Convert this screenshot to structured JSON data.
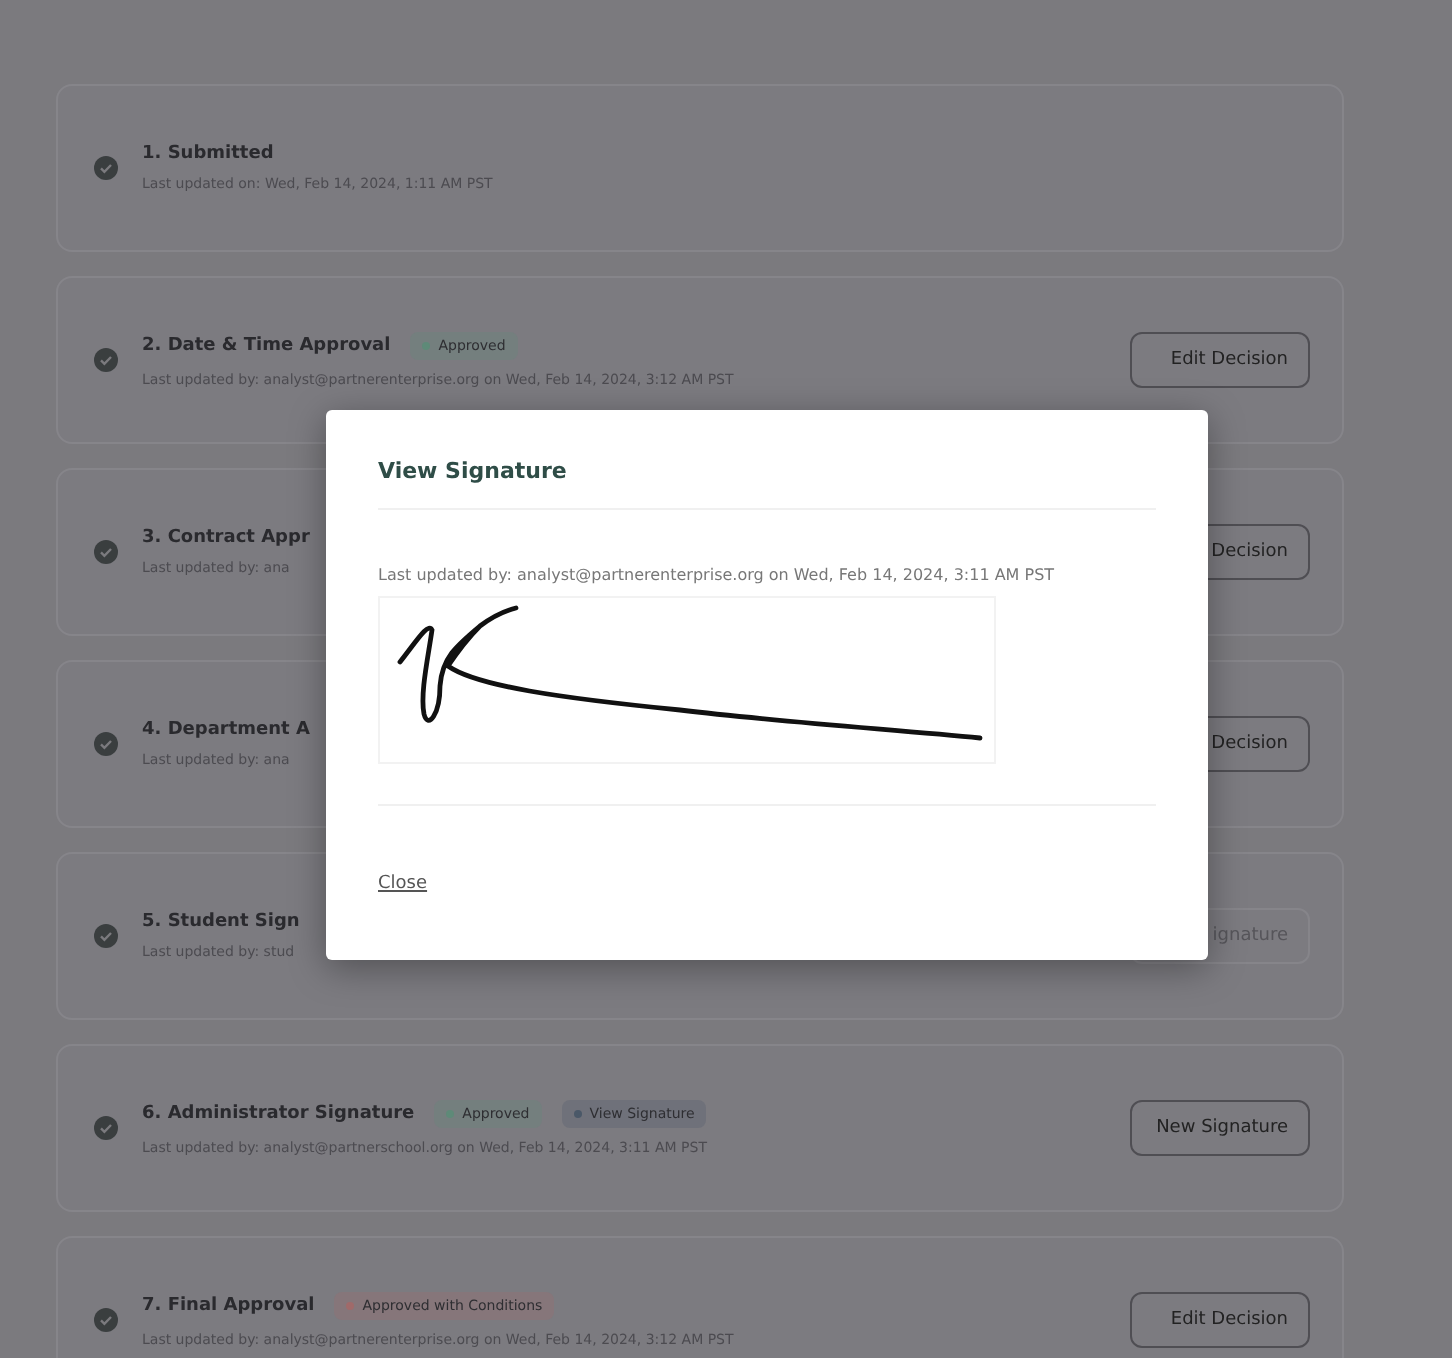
{
  "steps": [
    {
      "title": "1. Submitted",
      "subtitle": "Last updated on: Wed, Feb 14, 2024, 1:11 AM PST"
    },
    {
      "title": "2. Date & Time Approval",
      "subtitle": "Last updated by: analyst@partnerenterprise.org on Wed, Feb 14, 2024, 3:12 AM PST",
      "badges": [
        {
          "label": "Approved",
          "color": "#5e8a78"
        }
      ],
      "button": {
        "label": "Edit Decision",
        "disabled": false
      }
    },
    {
      "title": "3. Contract Appr",
      "subtitle": "Last updated by: ana",
      "button": {
        "label": "Decision",
        "disabled": false
      }
    },
    {
      "title": "4. Department A",
      "subtitle": "Last updated by: ana",
      "button": {
        "label": "Decision",
        "disabled": false
      }
    },
    {
      "title": "5. Student Sign",
      "subtitle": "Last updated by: stud",
      "button": {
        "label": "ignature",
        "disabled": true
      }
    },
    {
      "title": "6. Administrator Signature",
      "subtitle": "Last updated by: analyst@partnerschool.org on Wed, Feb 14, 2024, 3:11 AM PST",
      "badges": [
        {
          "label": "Approved",
          "color": "#5e8a78"
        },
        {
          "label": "View Signature",
          "color": "#4a5868"
        }
      ],
      "button": {
        "label": "New Signature",
        "disabled": false
      }
    },
    {
      "title": "7. Final Approval",
      "subtitle": "Last updated by: analyst@partnerenterprise.org on Wed, Feb 14, 2024, 3:12 AM PST",
      "badges": [
        {
          "label": "Approved with Conditions",
          "color": "#a06a6a"
        }
      ],
      "button": {
        "label": "Edit Decision",
        "disabled": false
      }
    }
  ],
  "modal": {
    "title": "View Signature",
    "text": "Last updated by: analyst@partnerenterprise.org on Wed, Feb 14, 2024, 3:11 AM PST",
    "close": "Close"
  }
}
